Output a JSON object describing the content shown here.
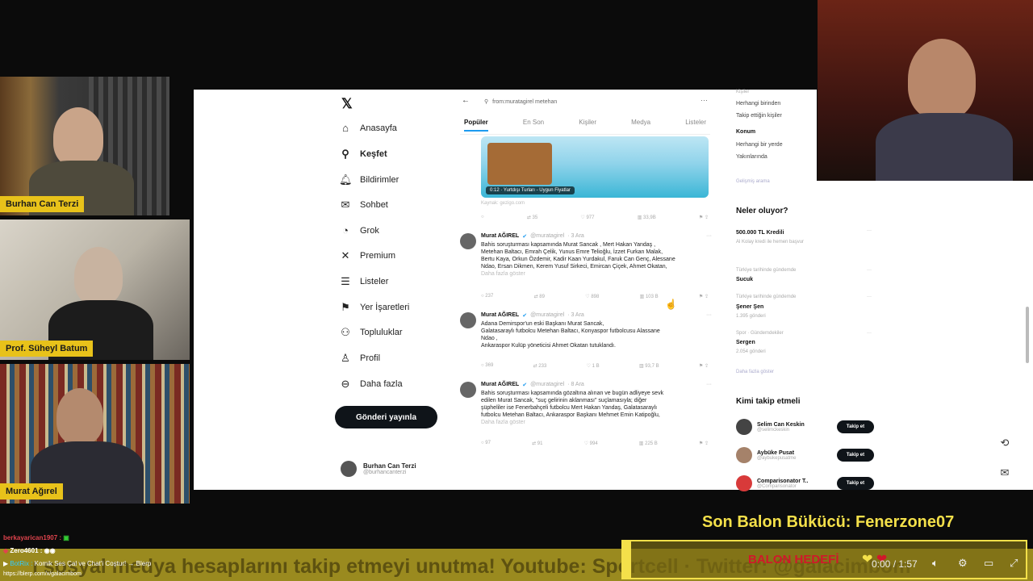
{
  "webcams": [
    {
      "name": "Burhan Can Terzi"
    },
    {
      "name": "Prof. Süheyl Batum"
    },
    {
      "name": "Murat Ağırel"
    }
  ],
  "x_nav": {
    "items": [
      {
        "label": "Anasayfa",
        "icon": "home-icon"
      },
      {
        "label": "Keşfet",
        "icon": "search-icon"
      },
      {
        "label": "Bildirimler",
        "icon": "bell-icon"
      },
      {
        "label": "Sohbet",
        "icon": "mail-icon"
      },
      {
        "label": "Grok",
        "icon": "grok-icon"
      },
      {
        "label": "Premium",
        "icon": "x-logo-icon"
      },
      {
        "label": "Listeler",
        "icon": "list-icon"
      },
      {
        "label": "Yer İşaretleri",
        "icon": "bookmark-icon"
      },
      {
        "label": "Topluluklar",
        "icon": "people-icon"
      },
      {
        "label": "Profil",
        "icon": "person-icon"
      },
      {
        "label": "Daha fazla",
        "icon": "more-circle-icon"
      }
    ],
    "post_button": "Gönderi yayınla",
    "account": {
      "name": "Burhan Can Terzi",
      "handle": "@burhancanterzi"
    }
  },
  "search": {
    "query": "from:muratagirel metehan"
  },
  "tabs": [
    "Popüler",
    "En Son",
    "Kişiler",
    "Medya",
    "Listeler"
  ],
  "media_card": {
    "caption": "0:12 · Yurtdışı Turları - Uygun Fiyatlar",
    "sub": "Kaynak: gezigo.com"
  },
  "first_actions": [
    "",
    "35",
    "977",
    "33,9B"
  ],
  "tweets": [
    {
      "author": "Murat AĞIREL",
      "handle": "@muratagirel",
      "time": "· 3 Ara",
      "text_lines": [
        "Bahis soruşturması kapsamında Murat Sancak , Mert Hakan Yandaş ,",
        "Metehan Baltacı, Emrah Çelik, Yunus Emre Telioğlu, İzzet Furkan Malak,",
        "Bertu Kaya, Orkun Özdemir, Kadir Kaan Yurdakul, Faruk Can Genç, Alessane",
        "Ndao, Ersan Dikmen, Kerem Yusuf Sirkeci, Emircan Çiçek, Ahmet Okatan,"
      ],
      "show_more": "Daha fazla göster",
      "actions": [
        "237",
        "89",
        "898",
        "103 B"
      ]
    },
    {
      "author": "Murat AĞIREL",
      "handle": "@muratagirel",
      "time": "· 3 Ara",
      "text_lines": [
        "Adana Demirspor'un eski Başkanı Murat Sancak,",
        "Galatasaraylı futbolcu Metehan Baltacı, Konyaspor futbolcusu Alassane",
        "Ndao ,",
        "Ankaraspor Kulüp yöneticisi Ahmet Okatan tutuklandı."
      ],
      "show_more": "",
      "actions": [
        "369",
        "233",
        "1 B",
        "93,7 B"
      ]
    },
    {
      "author": "Murat AĞIREL",
      "handle": "@muratagirel",
      "time": "· 8 Ara",
      "text_lines": [
        "Bahis soruşturması kapsamında gözaltına alınan ve bugün adliyeye sevk",
        "edilen Murat Sancak, \"suç gelirinin aklanması\" suçlamasıyla; diğer",
        "şüpheliler ise Fenerbahçeli futbolcu Mert Hakan Yandaş, Galatasaraylı",
        "futbolcu Metehan Baltacı, Ankaraspor Başkanı Mehmet Emin Katipoğlu,"
      ],
      "show_more": "Daha fazla göster",
      "actions": [
        "97",
        "91",
        "994",
        "225 B"
      ]
    }
  ],
  "sidebar": {
    "people_title": "Kişiler",
    "people_opts": [
      "Herhangi birinden",
      "Takip ettiğin kişiler"
    ],
    "location_title": "Konum",
    "location_opts": [
      "Herhangi bir yerde",
      "Yakınlarında"
    ],
    "advanced": "Gelişmiş arama",
    "trends_title": "Neler oluyor?",
    "trends": [
      {
        "context": "",
        "name": "500.000 TL Kredili",
        "meta": "Al Kolay kredi ile hemen başvur"
      },
      {
        "context": "Türkiye tarihinde gündemde",
        "name": "Sucuk",
        "meta": ""
      },
      {
        "context": "Türkiye tarihinde gündemde",
        "name": "Şener Şen",
        "meta": "1.395 gönderi"
      },
      {
        "context": "Spor · Gündemdekiler",
        "name": "Sergen",
        "meta": "2.054 gönderi"
      }
    ],
    "show_more": "Daha fazla göster",
    "who_title": "Kimi takip etmeli",
    "who": [
      {
        "name": "Selim Can Keskin",
        "handle": "@selimckeskin",
        "button": "Takip et"
      },
      {
        "name": "Aybüke Pusat",
        "handle": "@aybukepusatme",
        "button": "Takip et"
      },
      {
        "name": "Comparisonator T..",
        "handle": "@Comparisonator",
        "button": "Takip et"
      }
    ]
  },
  "overlay": {
    "balon_title": "Son Balon Bükücü: Fenerzone07",
    "ticker": "ı sosyal medya hesaplarını takip etmeyi unutma! Youtube: Sportcell · Twitter: @galacimbom",
    "goal_label": "BALON HEDEFİ",
    "goal_progress": 0.02,
    "chat": [
      {
        "user": "berkayarican1907 :",
        "text": ""
      },
      {
        "user": "Zero4601 :",
        "text": ""
      },
      {
        "user": "BotRix :",
        "text": "Komik Ses Çal ve Chat'i Coştur! → Blerp"
      },
      {
        "user": "",
        "text": "https://blerp.com/x/galacimbom"
      }
    ],
    "video_time": "0:00 / 1:57"
  }
}
